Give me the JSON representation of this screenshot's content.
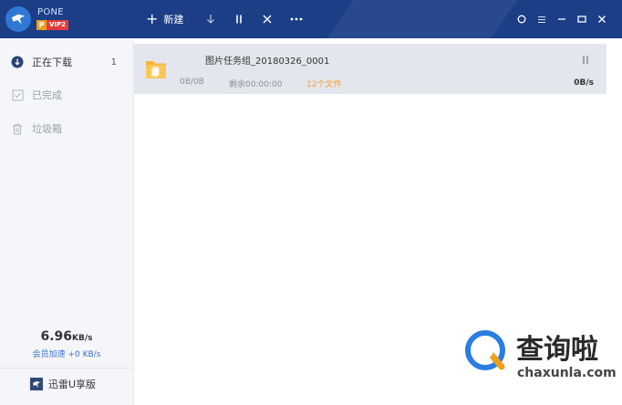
{
  "user": {
    "name": "PONE",
    "vip_p": "P",
    "vip_level": "VIP2"
  },
  "toolbar": {
    "new_label": "新建"
  },
  "colors": {
    "titlebar": "#1b3e86",
    "accent": "#3a6fcf",
    "file_count": "#f0a030"
  },
  "sidebar": {
    "items": [
      {
        "label": "正在下载",
        "count": "1",
        "icon": "download-circle-icon"
      },
      {
        "label": "已完成",
        "icon": "check-square-icon"
      },
      {
        "label": "垃圾箱",
        "icon": "trash-icon"
      }
    ],
    "speed": {
      "value": "6.96",
      "unit": "KB/s",
      "vip_label": "会员加速 +0 KB/s"
    },
    "u_learn": "迅雷U享版"
  },
  "tasks": [
    {
      "name": "图片任务组_20180326_0001",
      "size": "0B/0B",
      "remaining": "剩余00:00:00",
      "files": "12个文件",
      "speed": "0B/s"
    }
  ],
  "watermark": {
    "text": "查询啦",
    "url": "chaxunla.com"
  }
}
